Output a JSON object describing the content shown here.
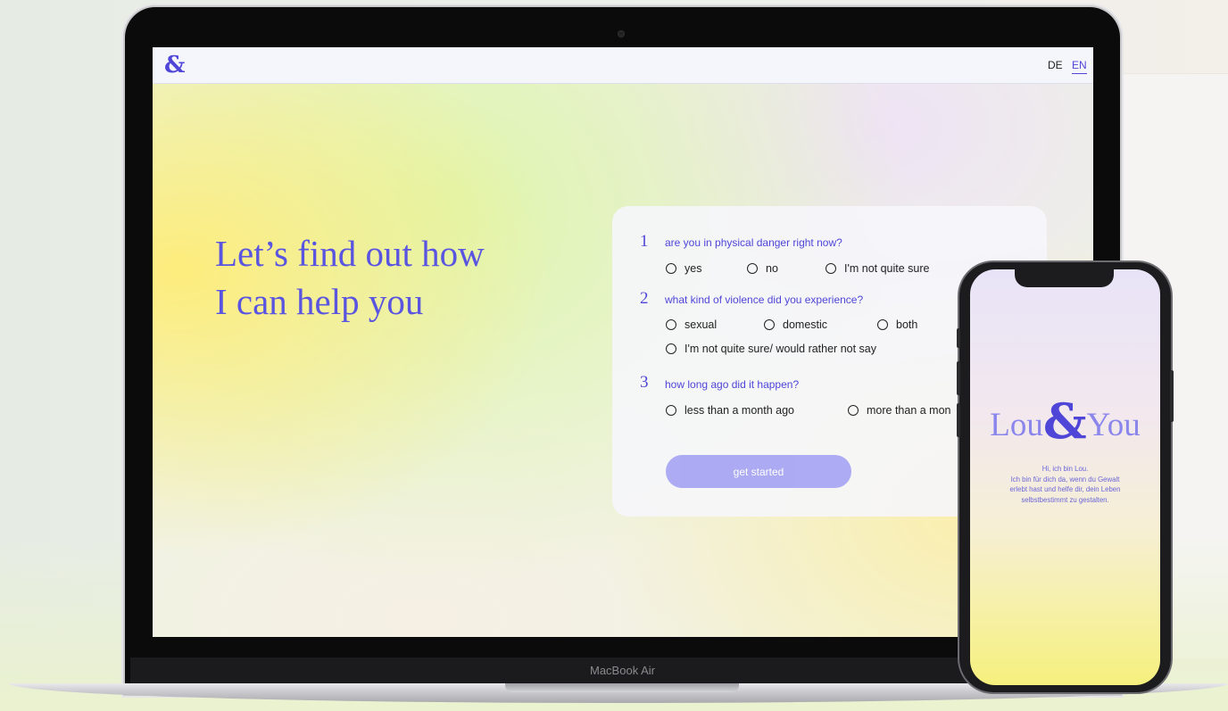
{
  "laptop": {
    "model_label": "MacBook Air",
    "topbar": {
      "logo": "&",
      "languages": [
        "DE",
        "EN"
      ],
      "active_language": "EN"
    },
    "headline": [
      "Let’s find out how",
      "I can help you"
    ],
    "quiz": {
      "questions": [
        {
          "number": "1",
          "text": "are you in physical danger right now?",
          "options": [
            "yes",
            "no",
            "I'm not quite sure"
          ]
        },
        {
          "number": "2",
          "text": "what kind of violence did you experience?",
          "options": [
            "sexual",
            "domestic",
            "both",
            "I'm not quite sure/ would rather not say"
          ]
        },
        {
          "number": "3",
          "text": "how long ago did it happen?",
          "options": [
            "less than a month ago",
            "more than a mon"
          ]
        }
      ],
      "submit_label": "get started"
    }
  },
  "phone": {
    "brand": {
      "left": "Lou",
      "amp": "&",
      "right": "You"
    },
    "welcome_lines": [
      "Hi, ich bin Lou.",
      "Ich bin für dich da, wenn du Gewalt",
      "erlebt hast und helfe dir, dein Leben",
      "selbstbestimmt zu gestalten."
    ]
  },
  "colors": {
    "accent": "#4f46d8",
    "button": "#a9a6f2",
    "headline": "#5a55e0"
  }
}
